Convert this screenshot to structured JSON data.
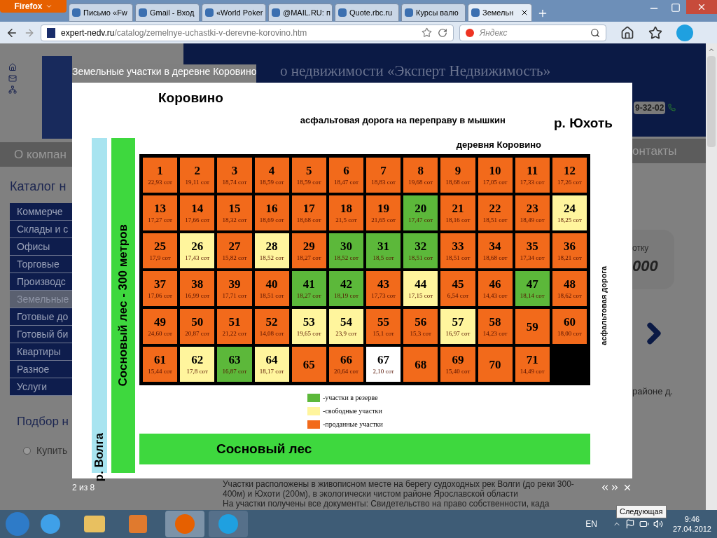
{
  "browser": {
    "menu_button": "Firefox",
    "tabs": [
      {
        "label": "Письмо «Fw",
        "selected": false
      },
      {
        "label": "Gmail - Вход",
        "selected": false
      },
      {
        "label": "«World Poker",
        "selected": false
      },
      {
        "label": "@MAIL.RU: п",
        "selected": false
      },
      {
        "label": "Quote.rbc.ru",
        "selected": false
      },
      {
        "label": "Курсы валю",
        "selected": false
      },
      {
        "label": "Земельн",
        "selected": true
      }
    ],
    "url_domain": "expert-nedv.ru",
    "url_path": "/catalog/zemelnye-uchastki-v-derevne-korovino.htm",
    "search_placeholder": "Яндекс"
  },
  "page": {
    "header_title": "о недвижимости «Эксперт Недвижимость»",
    "phone": "9-32-02",
    "nav_left": "О компан",
    "nav_right": "онтакты",
    "catalog_title": "Каталог н",
    "catalog": [
      {
        "label": "Коммерче",
        "selected": false
      },
      {
        "label": "Склады и с",
        "selected": false
      },
      {
        "label": "Офисы",
        "selected": false
      },
      {
        "label": "Торговые",
        "selected": false
      },
      {
        "label": "Производс",
        "selected": false
      },
      {
        "label": "Земельные",
        "selected": true
      },
      {
        "label": "Готовые до",
        "selected": false
      },
      {
        "label": "Готовый би",
        "selected": false
      },
      {
        "label": "Квартиры",
        "selected": false
      },
      {
        "label": "Разное",
        "selected": false
      },
      {
        "label": "Услуги",
        "selected": false
      }
    ],
    "search_title": "Подбор н",
    "radio_label": "Купить",
    "radio_checked": false,
    "promo_caption": "отку",
    "promo_value": "000",
    "side_text": "районе д.",
    "bullets": [
      "Участки расположены в живописном месте на берегу судоходных рек Волги (до реки 300-400м) и Юхоти (200м), в экологически чистом районе Ярославской области",
      "На участки получены все документы: Свидетельство на право собственности, када"
    ]
  },
  "lightbox": {
    "title": "Земельные участки в деревне Коровино",
    "counter": "2 из 8",
    "tooltip": "Следующая",
    "map": {
      "village_top": "Коровино",
      "river_right": "р. Юхоть",
      "road_top": "асфальтовая дорога на переправу в мышкин",
      "village_label": "деревня Коровино",
      "forest_left": "Сосновый лес - 300 метров",
      "river_left": "р. Волга",
      "road_right": "асфальтовая дорога",
      "forest_bottom": "Сосновый лес",
      "legend": [
        {
          "color": "#5cb83a",
          "label": "-участки в резерве"
        },
        {
          "color": "#fff59d",
          "label": "-свободные участки"
        },
        {
          "color": "#f26a1b",
          "label": "-проданные участки"
        }
      ],
      "plots": [
        {
          "number": "1",
          "area": "22,93 сот",
          "color": "#f26a1b"
        },
        {
          "number": "2",
          "area": "19,11 сот",
          "color": "#f26a1b"
        },
        {
          "number": "3",
          "area": "18,74 сот",
          "color": "#f26a1b"
        },
        {
          "number": "4",
          "area": "18,59 сот",
          "color": "#f26a1b"
        },
        {
          "number": "5",
          "area": "18,59 сот",
          "color": "#f26a1b"
        },
        {
          "number": "6",
          "area": "18,47 сот",
          "color": "#f26a1b"
        },
        {
          "number": "7",
          "area": "18,83 сот",
          "color": "#f26a1b"
        },
        {
          "number": "8",
          "area": "19,68 сот",
          "color": "#f26a1b"
        },
        {
          "number": "9",
          "area": "18,68 сот",
          "color": "#f26a1b"
        },
        {
          "number": "10",
          "area": "17,05 сот",
          "color": "#f26a1b"
        },
        {
          "number": "11",
          "area": "17,33 сот",
          "color": "#f26a1b"
        },
        {
          "number": "12",
          "area": "17,26 сот",
          "color": "#f26a1b"
        },
        {
          "number": "13",
          "area": "17,27 сот",
          "color": "#f26a1b"
        },
        {
          "number": "14",
          "area": "17,66 сот",
          "color": "#f26a1b"
        },
        {
          "number": "15",
          "area": "18,32 сот",
          "color": "#f26a1b"
        },
        {
          "number": "16",
          "area": "18,69 сот",
          "color": "#f26a1b"
        },
        {
          "number": "17",
          "area": "18,68 сот",
          "color": "#f26a1b"
        },
        {
          "number": "18",
          "area": "21,5 сот",
          "color": "#f26a1b"
        },
        {
          "number": "19",
          "area": "21,65 сот",
          "color": "#f26a1b"
        },
        {
          "number": "20",
          "area": "17,47 сот",
          "color": "#5cb83a"
        },
        {
          "number": "21",
          "area": "18,16 сот",
          "color": "#f26a1b"
        },
        {
          "number": "22",
          "area": "18,51 сот",
          "color": "#f26a1b"
        },
        {
          "number": "23",
          "area": "18,49 сот",
          "color": "#f26a1b"
        },
        {
          "number": "24",
          "area": "18,25 сот",
          "color": "#fff59d"
        },
        {
          "number": "25",
          "area": "17,9 сот",
          "color": "#f26a1b"
        },
        {
          "number": "26",
          "area": "17,43 сот",
          "color": "#fff59d"
        },
        {
          "number": "27",
          "area": "15,82 сот",
          "color": "#f26a1b"
        },
        {
          "number": "28",
          "area": "18,52 сот",
          "color": "#fff59d"
        },
        {
          "number": "29",
          "area": "18,27 сот",
          "color": "#f26a1b"
        },
        {
          "number": "30",
          "area": "18,52 сот",
          "color": "#5cb83a"
        },
        {
          "number": "31",
          "area": "18,5 сот",
          "color": "#5cb83a"
        },
        {
          "number": "32",
          "area": "18,51 сот",
          "color": "#5cb83a"
        },
        {
          "number": "33",
          "area": "18,51 сот",
          "color": "#f26a1b"
        },
        {
          "number": "34",
          "area": "18,68 сот",
          "color": "#f26a1b"
        },
        {
          "number": "35",
          "area": "17,34 сот",
          "color": "#f26a1b"
        },
        {
          "number": "36",
          "area": "18,21 сот",
          "color": "#f26a1b"
        },
        {
          "number": "37",
          "area": "17,06 сот",
          "color": "#f26a1b"
        },
        {
          "number": "38",
          "area": "16,99 сот",
          "color": "#f26a1b"
        },
        {
          "number": "39",
          "area": "17,71 сот",
          "color": "#f26a1b"
        },
        {
          "number": "40",
          "area": "18,51 сот",
          "color": "#f26a1b"
        },
        {
          "number": "41",
          "area": "18,27 сот",
          "color": "#5cb83a"
        },
        {
          "number": "42",
          "area": "18,19 сот",
          "color": "#5cb83a"
        },
        {
          "number": "43",
          "area": "17,73 сот",
          "color": "#f26a1b"
        },
        {
          "number": "44",
          "area": "17,15 сот",
          "color": "#fff59d"
        },
        {
          "number": "45",
          "area": "6,54 сот",
          "color": "#f26a1b"
        },
        {
          "number": "46",
          "area": "14,43 сот",
          "color": "#f26a1b"
        },
        {
          "number": "47",
          "area": "18,14 сот",
          "color": "#5cb83a"
        },
        {
          "number": "48",
          "area": "18,62 сот",
          "color": "#f26a1b"
        },
        {
          "number": "49",
          "area": "24,60 сот",
          "color": "#f26a1b"
        },
        {
          "number": "50",
          "area": "20,87 сот",
          "color": "#f26a1b"
        },
        {
          "number": "51",
          "area": "21,22 сот",
          "color": "#f26a1b"
        },
        {
          "number": "52",
          "area": "14,08 сот",
          "color": "#f26a1b"
        },
        {
          "number": "53",
          "area": "19,65 сот",
          "color": "#fff59d"
        },
        {
          "number": "54",
          "area": "23,9 сот",
          "color": "#fff59d"
        },
        {
          "number": "55",
          "area": "15,1 сот",
          "color": "#f26a1b"
        },
        {
          "number": "56",
          "area": "15,3 сот",
          "color": "#f26a1b"
        },
        {
          "number": "57",
          "area": "16,97 сот",
          "color": "#fff59d"
        },
        {
          "number": "58",
          "area": "14,23 сот",
          "color": "#f26a1b"
        },
        {
          "number": "59",
          "color": "#f26a1b"
        },
        {
          "number": "60",
          "area": "18,00 сот",
          "color": "#f26a1b"
        },
        {
          "number": "61",
          "area": "15,44 сот",
          "color": "#f26a1b"
        },
        {
          "number": "62",
          "area": "17,8 сот",
          "color": "#fff59d"
        },
        {
          "number": "63",
          "area": "16,87 сот",
          "color": "#5cb83a"
        },
        {
          "number": "64",
          "area": "18,17 сот",
          "color": "#fff59d"
        },
        {
          "number": "65",
          "color": "#f26a1b"
        },
        {
          "number": "66",
          "area": "20,64 сот",
          "color": "#f26a1b"
        },
        {
          "number": "67",
          "area": "2,10 сот",
          "color": "#ffffff"
        },
        {
          "number": "68",
          "color": "#f26a1b"
        },
        {
          "number": "69",
          "area": "15,40 сот",
          "color": "#f26a1b"
        },
        {
          "number": "70",
          "color": "#f26a1b"
        },
        {
          "number": "71",
          "area": "14,49 сот",
          "color": "#f26a1b"
        }
      ]
    }
  },
  "taskbar": {
    "language": "EN",
    "time": "9:46",
    "date": "27.04.2012"
  }
}
